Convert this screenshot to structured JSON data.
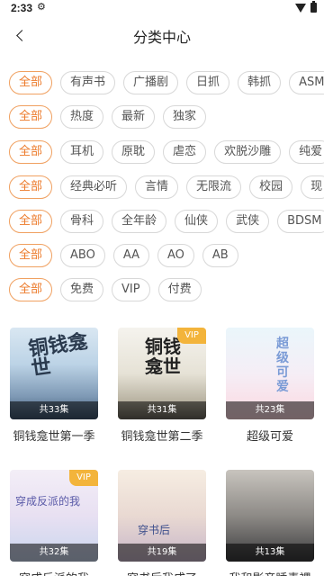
{
  "status_bar": {
    "time": "2:33",
    "gear_icon": "gear-icon",
    "wifi_icon": "wifi-icon",
    "battery_icon": "battery-icon"
  },
  "header": {
    "title": "分类中心",
    "back_icon": "chevron-left-icon"
  },
  "colors": {
    "accent": "#ec7a2a",
    "vip": "#f3b43b",
    "chip_border": "#d8d8d8"
  },
  "filters": [
    {
      "chips": [
        "全部",
        "有声书",
        "广播剧",
        "日抓",
        "韩抓",
        "ASM"
      ]
    },
    {
      "chips": [
        "全部",
        "热度",
        "最新",
        "独家"
      ]
    },
    {
      "chips": [
        "全部",
        "耳机",
        "原耽",
        "虐恋",
        "欢脱沙雕",
        "纯爱"
      ]
    },
    {
      "chips": [
        "全部",
        "经典必听",
        "言情",
        "无限流",
        "校园",
        "现"
      ]
    },
    {
      "chips": [
        "全部",
        "骨科",
        "全年龄",
        "仙侠",
        "武侠",
        "BDSM"
      ]
    },
    {
      "chips": [
        "全部",
        "ABO",
        "AA",
        "AO",
        "AB"
      ]
    },
    {
      "chips": [
        "全部",
        "免费",
        "VIP",
        "付费"
      ]
    }
  ],
  "cards": [
    {
      "title": "铜钱龛世第一季",
      "episodes": "共33集",
      "vip": "",
      "cover_text": "铜钱龛世"
    },
    {
      "title": "铜钱龛世第二季",
      "episodes": "共31集",
      "vip": "VIP",
      "cover_text": "铜钱龛世"
    },
    {
      "title": "超级可爱",
      "episodes": "共23集",
      "vip": "",
      "cover_text": "超级可爱"
    },
    {
      "title": "穿成反派的我",
      "episodes": "共32集",
      "vip": "VIP",
      "cover_text": "穿成反派的我"
    },
    {
      "title": "穿书后我成了",
      "episodes": "共19集",
      "vip": "",
      "cover_text": "穿书后"
    },
    {
      "title": "我和影帝睡素裸",
      "episodes": "共13集",
      "vip": "",
      "cover_text": ""
    }
  ]
}
